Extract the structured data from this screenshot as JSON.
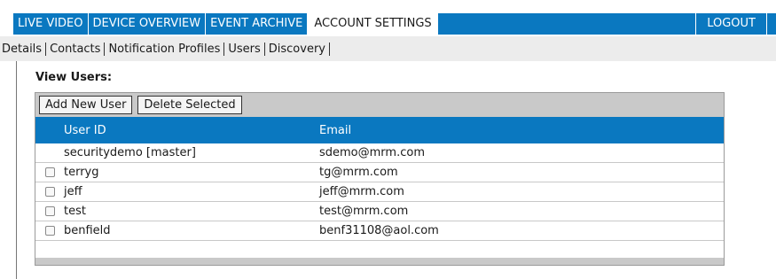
{
  "topnav": {
    "items": [
      {
        "label": "LIVE VIDEO"
      },
      {
        "label": "DEVICE OVERVIEW"
      },
      {
        "label": "EVENT ARCHIVE"
      },
      {
        "label": "ACCOUNT SETTINGS",
        "active": true
      }
    ],
    "logout_label": "LOGOUT"
  },
  "subnav": {
    "items": [
      {
        "label": "Details"
      },
      {
        "label": "Contacts"
      },
      {
        "label": "Notification Profiles"
      },
      {
        "label": "Users"
      },
      {
        "label": "Discovery"
      }
    ]
  },
  "section": {
    "title": "View Users:"
  },
  "toolbar": {
    "add_label": "Add New User",
    "delete_label": "Delete Selected"
  },
  "table": {
    "headers": {
      "user_id": "User ID",
      "email": "Email"
    },
    "rows": [
      {
        "user_id": "securitydemo [master]",
        "email": "sdemo@mrm.com",
        "checkbox": false
      },
      {
        "user_id": "terryg",
        "email": "tg@mrm.com",
        "checkbox": true
      },
      {
        "user_id": "jeff",
        "email": "jeff@mrm.com",
        "checkbox": true
      },
      {
        "user_id": "test",
        "email": "test@mrm.com",
        "checkbox": true
      },
      {
        "user_id": "benfield",
        "email": "benf31108@aol.com",
        "checkbox": true
      }
    ]
  },
  "colors": {
    "accent": "#0a78c0",
    "toolbar_gray": "#c9c9c9",
    "subnav_gray": "#ececec"
  }
}
